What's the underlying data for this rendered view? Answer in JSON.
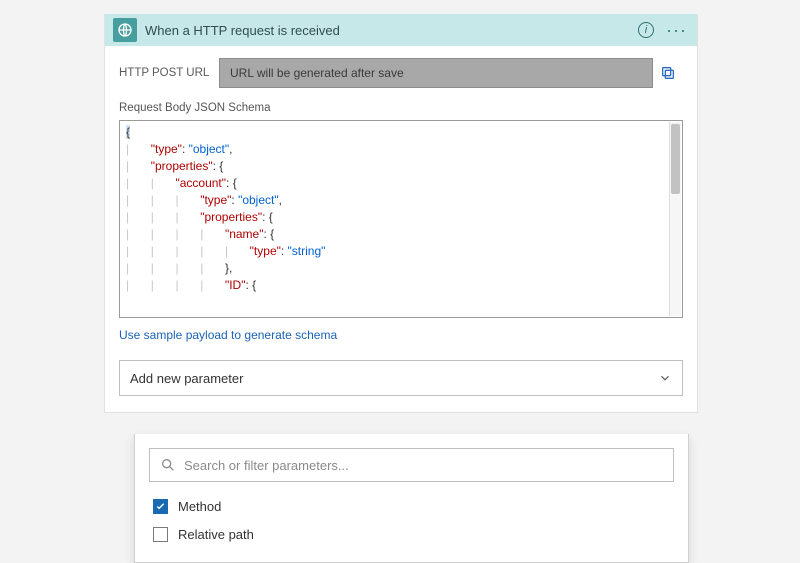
{
  "header": {
    "title": "When a HTTP request is received"
  },
  "url_row": {
    "label": "HTTP POST URL",
    "placeholder_box": "URL will be generated after save"
  },
  "schema": {
    "label": "Request Body JSON Schema",
    "link": "Use sample payload to generate schema",
    "lines": [
      {
        "indent": 0,
        "tokens": [
          {
            "t": "{",
            "c": "punct",
            "sel": true
          }
        ]
      },
      {
        "indent": 1,
        "tokens": [
          {
            "t": "\"type\"",
            "c": "tok-key"
          },
          {
            "t": ": ",
            "c": "punct"
          },
          {
            "t": "\"object\"",
            "c": "tok-str"
          },
          {
            "t": ",",
            "c": "punct"
          }
        ]
      },
      {
        "indent": 1,
        "tokens": [
          {
            "t": "\"properties\"",
            "c": "tok-key"
          },
          {
            "t": ": {",
            "c": "punct"
          }
        ]
      },
      {
        "indent": 2,
        "tokens": [
          {
            "t": "\"account\"",
            "c": "tok-key"
          },
          {
            "t": ": {",
            "c": "punct"
          }
        ]
      },
      {
        "indent": 3,
        "tokens": [
          {
            "t": "\"type\"",
            "c": "tok-key"
          },
          {
            "t": ": ",
            "c": "punct"
          },
          {
            "t": "\"object\"",
            "c": "tok-str"
          },
          {
            "t": ",",
            "c": "punct"
          }
        ]
      },
      {
        "indent": 3,
        "tokens": [
          {
            "t": "\"properties\"",
            "c": "tok-key"
          },
          {
            "t": ": {",
            "c": "punct"
          }
        ]
      },
      {
        "indent": 4,
        "tokens": [
          {
            "t": "\"name\"",
            "c": "tok-key"
          },
          {
            "t": ": {",
            "c": "punct"
          }
        ]
      },
      {
        "indent": 5,
        "tokens": [
          {
            "t": "\"type\"",
            "c": "tok-key"
          },
          {
            "t": ": ",
            "c": "punct"
          },
          {
            "t": "\"string\"",
            "c": "tok-str"
          }
        ]
      },
      {
        "indent": 4,
        "tokens": [
          {
            "t": "},",
            "c": "punct"
          }
        ]
      },
      {
        "indent": 4,
        "tokens": [
          {
            "t": "\"ID\"",
            "c": "tok-key"
          },
          {
            "t": ": {",
            "c": "punct"
          }
        ]
      }
    ]
  },
  "add_parameter": {
    "label": "Add new parameter"
  },
  "dropdown": {
    "search_placeholder": "Search or filter parameters...",
    "options": [
      {
        "label": "Method",
        "checked": true
      },
      {
        "label": "Relative path",
        "checked": false
      }
    ]
  }
}
